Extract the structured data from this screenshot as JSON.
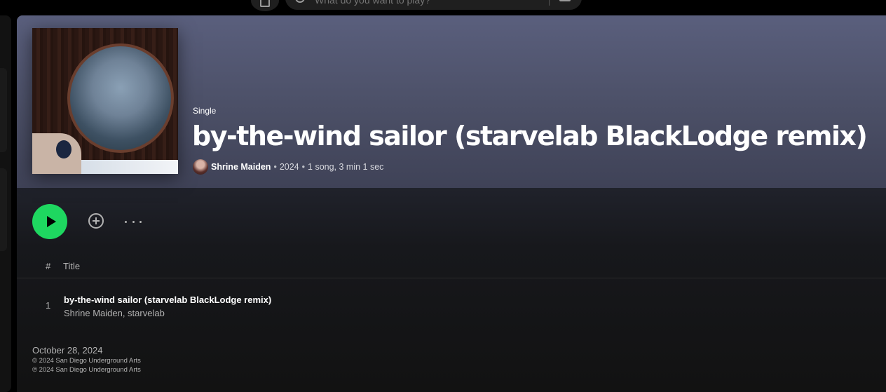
{
  "topbar": {
    "search_placeholder": "What do you want to play?"
  },
  "album": {
    "type_label": "Single",
    "title": "by-the-wind sailor (starvelab BlackLodge remix)",
    "artist": "Shrine Maiden",
    "year": "2024",
    "summary": "1 song, 3 min 1 sec",
    "separator": "•"
  },
  "tracklist": {
    "header_number": "#",
    "header_title": "Title",
    "tracks": [
      {
        "number": "1",
        "title": "by-the-wind sailor (starvelab BlackLodge remix)",
        "artists": "Shrine Maiden, starvelab"
      }
    ]
  },
  "footer": {
    "release_date": "October 28, 2024",
    "copyright": "© 2024 San Diego Underground Arts",
    "phonogram": "℗ 2024 San Diego Underground Arts"
  },
  "colors": {
    "accent": "#1ed760",
    "hero_top": "#5a5f7d",
    "background": "#121212"
  },
  "icons": [
    "home-icon",
    "search-icon",
    "browse-icon",
    "play-icon",
    "add-circle-icon",
    "more-icon"
  ]
}
